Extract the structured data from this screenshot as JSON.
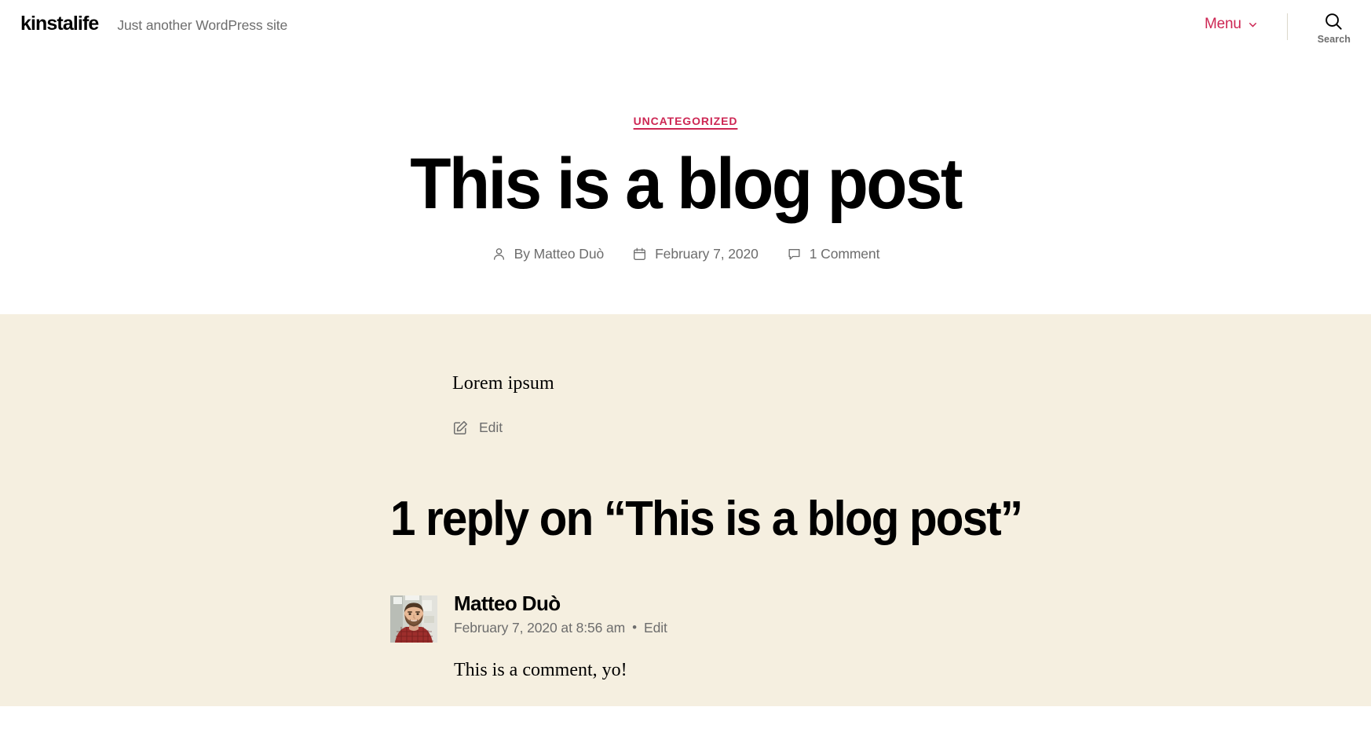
{
  "header": {
    "site_title": "kinstalife",
    "tagline": "Just another WordPress site",
    "menu_label": "Menu",
    "search_label": "Search"
  },
  "entry": {
    "category": "UNCATEGORIZED",
    "title": "This is a blog post",
    "meta": {
      "author_prefix": "By",
      "author": "Matteo Duò",
      "author_full": "By Matteo Duò",
      "date": "February 7, 2020",
      "comments": "1 Comment"
    },
    "content_paragraph": "Lorem ipsum",
    "edit_label": "Edit"
  },
  "comments": {
    "title": "1 reply on “This is a blog post”",
    "list": [
      {
        "author": "Matteo Duò",
        "date": "February 7, 2020 at 8:56 am",
        "separator": "•",
        "edit_label": "Edit",
        "text": "This is a comment, yo!"
      }
    ]
  },
  "colors": {
    "accent": "#cd2653",
    "page_bg": "#ffffff",
    "body_bg": "#f5efe0",
    "muted_text": "#6d6d6d",
    "primary_text": "#000000",
    "divider": "#dcd7ca"
  },
  "icons": {
    "chevron_down": "chevron-down-icon",
    "search": "search-icon",
    "person": "person-icon",
    "calendar": "calendar-icon",
    "comment_bubble": "comment-bubble-icon",
    "pencil_square": "pencil-square-icon"
  }
}
